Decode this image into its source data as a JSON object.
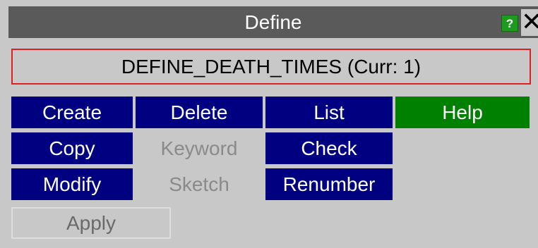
{
  "window": {
    "title": "Define",
    "help_icon_glyph": "?",
    "close_icon_glyph": "✕"
  },
  "keyword": {
    "label": "DEFINE_DEATH_TIMES (Curr: 1)"
  },
  "buttons": {
    "create": "Create",
    "delete": "Delete",
    "list": "List",
    "help": "Help",
    "copy": "Copy",
    "keyword": "Keyword",
    "check": "Check",
    "modify": "Modify",
    "sketch": "Sketch",
    "renumber": "Renumber",
    "apply": "Apply"
  },
  "colors": {
    "active_button": "#000080",
    "help_button": "#008000",
    "title_bar": "#5a5a5a",
    "keyword_border": "#e02020",
    "panel_background": "#c8c8c8",
    "disabled_text": "#8a8a8a"
  },
  "icons": {
    "help": "question-icon",
    "close": "close-icon"
  }
}
